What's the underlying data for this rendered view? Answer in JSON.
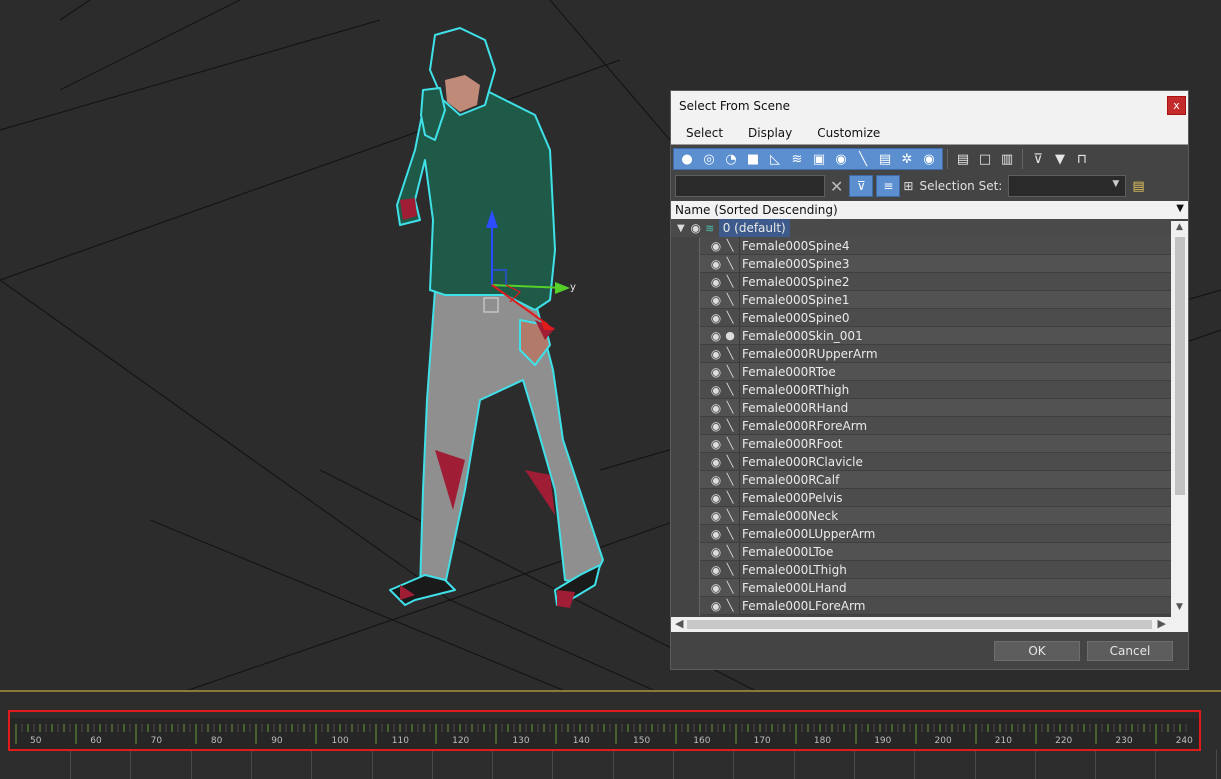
{
  "dialog": {
    "title": "Select From Scene",
    "close_label": "x",
    "menu": [
      "Select",
      "Display",
      "Customize"
    ],
    "search_value": "",
    "selection_set_label": "Selection Set:",
    "selection_set_value": "",
    "column_header": "Name (Sorted Descending)",
    "layer_name": "0 (default)",
    "items": [
      "Female000Spine4",
      "Female000Spine3",
      "Female000Spine2",
      "Female000Spine1",
      "Female000Spine0",
      "Female000Skin_001",
      "Female000RUpperArm",
      "Female000RToe",
      "Female000RThigh",
      "Female000RHand",
      "Female000RForeArm",
      "Female000RFoot",
      "Female000RClavicle",
      "Female000RCalf",
      "Female000Pelvis",
      "Female000Neck",
      "Female000LUpperArm",
      "Female000LToe",
      "Female000LThigh",
      "Female000LHand",
      "Female000LForeArm"
    ],
    "ok_label": "OK",
    "cancel_label": "Cancel"
  },
  "viewport": {
    "gizmo_y_label": "y"
  },
  "timeline": {
    "ticks": [
      "50",
      "60",
      "70",
      "80",
      "90",
      "100",
      "110",
      "120",
      "130",
      "140",
      "150",
      "160",
      "170",
      "180",
      "190",
      "200",
      "210",
      "220",
      "230",
      "240"
    ]
  },
  "colors": {
    "accent": "#5b8fd0",
    "highlight": "#e01b1b",
    "outline": "#3fe0e8"
  }
}
